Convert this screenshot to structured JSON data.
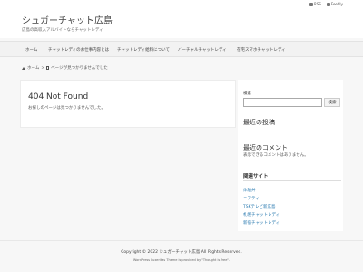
{
  "topbar": {
    "rss_label": "RSS",
    "feedly_label": "Feedly"
  },
  "site": {
    "title": "シュガーチャット広島",
    "description": "広島の高収入アルバイトならチャットレディ"
  },
  "nav": {
    "items": [
      "ホーム",
      "チャットレディのお仕事内容とは",
      "チャットレディ給料について",
      "バーチャルチャットレディ",
      "在宅スマホチャットレディ"
    ]
  },
  "breadcrumb": {
    "home": "ホーム",
    "current": "ページが見つかりませんでした"
  },
  "main": {
    "title": "404 Not Found",
    "message": "お探しのページは見つかりませんでした。"
  },
  "sidebar": {
    "search_label": "検索",
    "search_value": "",
    "search_button": "検索",
    "recent_posts_title": "最近の投稿",
    "recent_comments_title": "最近のコメント",
    "no_comments": "表示できるコメントはありません。",
    "related_title": "関連サイト",
    "related_links": [
      "体験丼",
      "ニアティ",
      "TSKテレビ新広島",
      "札幌チャットレディ",
      "新宿チャットレディ"
    ]
  },
  "footer": {
    "copyright": "Copyright © 2022 シュガーチャット広島 All Rights Reserved.",
    "credit": "WordPress Luxeritas Theme is provided by \"Thought is free\"."
  }
}
